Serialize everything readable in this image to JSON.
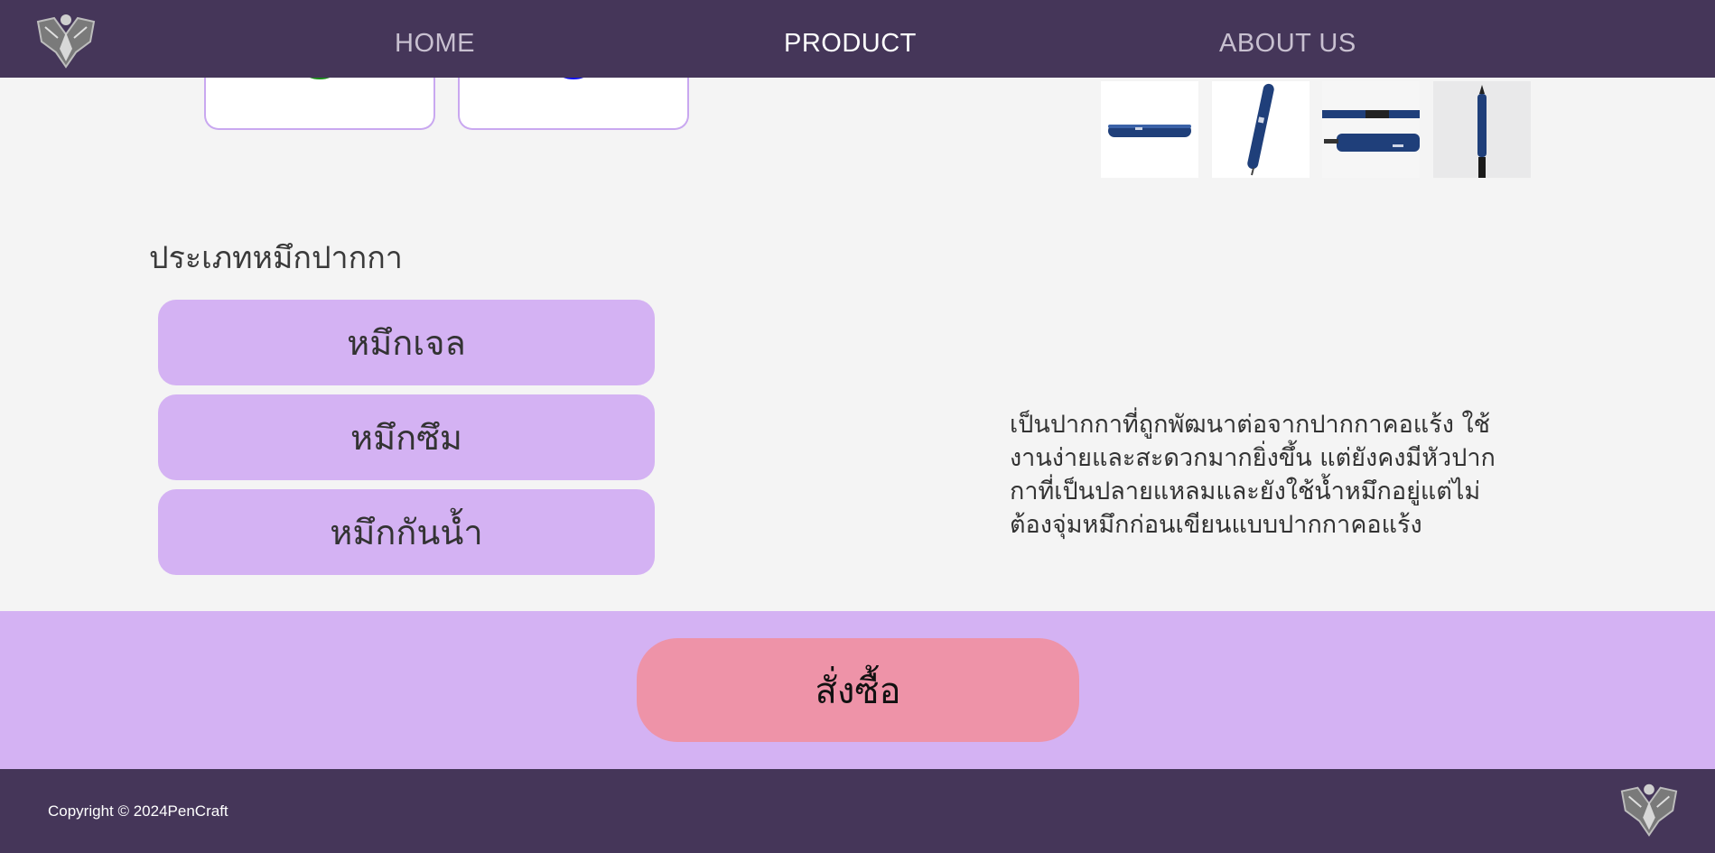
{
  "nav": {
    "logo_icon": "pencraft-emblem-icon",
    "links": [
      "HOME",
      "PRODUCT",
      "ABOUT US"
    ],
    "active": "PRODUCT"
  },
  "colors": {
    "nav_bg": "#453659",
    "accent_purple": "#d4b2f3",
    "order_pink": "#ee93a8",
    "swatch_green": "#1a8a1a",
    "swatch_blue": "#1010ee"
  },
  "swatches": [
    {
      "color": "#1a8a1a",
      "name": "green"
    },
    {
      "color": "#1010ee",
      "name": "blue"
    }
  ],
  "thumbnails": [
    "pen-horizontal",
    "pen-diagonal",
    "pen-parts",
    "pen-vertical"
  ],
  "ink": {
    "title": "ประเภทหมึกปากกา",
    "options": [
      "หมึกเจล",
      "หมึกซึม",
      "หมึกกันน้ำ"
    ]
  },
  "description_lines": [
    "เป็นปากกาที่ถูกพัฒนาต่อจากปากกาคอแร้ง ใช้",
    "งานง่ายและสะดวกมากยิ่งขึ้น แต่ยังคงมีหัวปาก",
    "กาที่เป็นปลายแหลมและยังใช้น้ำหมึกอยู่แต่ไม่",
    "ต้องจุ่มหมึกก่อนเขียนแบบปากกาคอแร้ง"
  ],
  "order": {
    "label": "สั่งซื้อ"
  },
  "footer": {
    "copyright": "Copyright © 2024PenCraft",
    "logo_icon": "pencraft-emblem-icon"
  }
}
